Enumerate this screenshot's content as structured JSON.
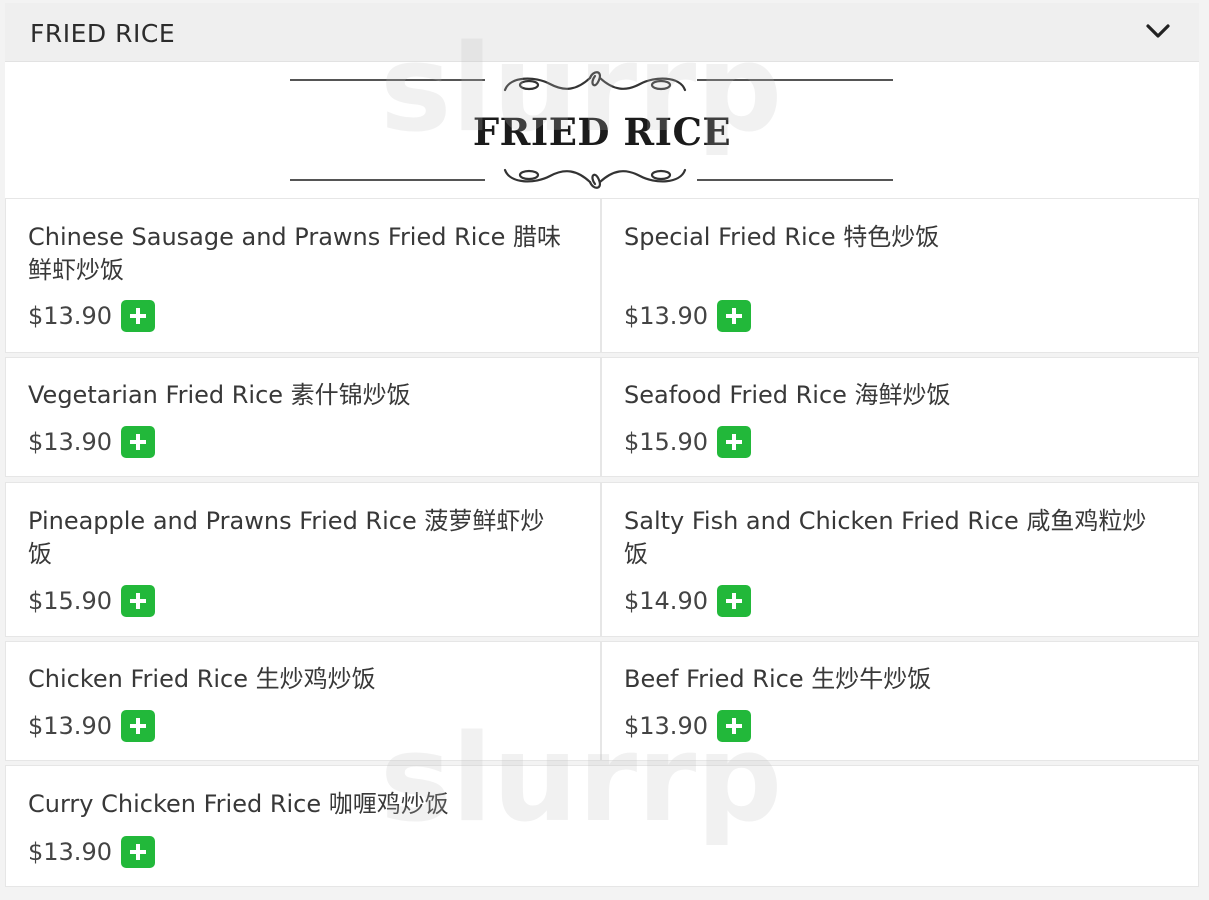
{
  "section": {
    "title": "FRIED RICE"
  },
  "banner": {
    "title": "FRIED RICE"
  },
  "items": [
    {
      "name": "Chinese Sausage and Prawns Fried Rice 腊味鲜虾炒饭",
      "price": "$13.90"
    },
    {
      "name": "Special Fried Rice 特色炒饭",
      "price": "$13.90"
    },
    {
      "name": "Vegetarian Fried Rice 素什锦炒饭",
      "price": "$13.90"
    },
    {
      "name": "Seafood Fried Rice 海鲜炒饭",
      "price": "$15.90"
    },
    {
      "name": "Pineapple and Prawns Fried Rice 菠萝鲜虾炒饭",
      "price": "$15.90"
    },
    {
      "name": "Salty Fish and Chicken Fried Rice 咸鱼鸡粒炒饭",
      "price": "$14.90"
    },
    {
      "name": "Chicken Fried Rice 生炒鸡炒饭",
      "price": "$13.90"
    },
    {
      "name": "Beef Fried Rice 生炒牛炒饭",
      "price": "$13.90"
    },
    {
      "name": "Curry Chicken Fried Rice 咖喱鸡炒饭",
      "price": "$13.90"
    }
  ],
  "icons": {
    "collapse": "chevron-down-icon",
    "add": "plus-icon"
  },
  "colors": {
    "add_button": "#22b83a",
    "header_bg": "#efefef"
  },
  "watermark": "slurrp"
}
